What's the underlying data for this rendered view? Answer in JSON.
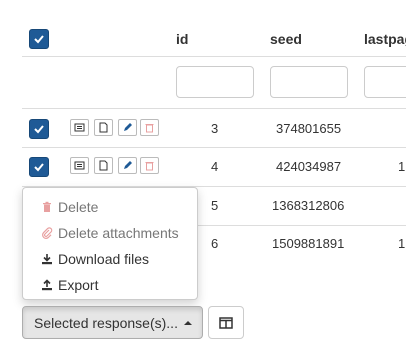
{
  "table": {
    "headers": [
      "id",
      "seed",
      "lastpage"
    ],
    "rows": [
      {
        "checked": true,
        "id": "3",
        "seed": "374801655",
        "lastpage": ""
      },
      {
        "checked": true,
        "id": "4",
        "seed": "424034987",
        "lastpage": "1"
      },
      {
        "checked": false,
        "id": "5",
        "seed": "1368312806",
        "lastpage": ""
      },
      {
        "checked": false,
        "id": "6",
        "seed": "1509881891",
        "lastpage": "1"
      }
    ],
    "header_label_partial": "lastpag"
  },
  "dropdown": {
    "items": [
      {
        "label": "Delete",
        "icon": "trash-icon",
        "color": "#e8a0a0"
      },
      {
        "label": "Delete attachments",
        "icon": "paperclip-icon",
        "color": "#e8a0a0"
      },
      {
        "label": "Download files",
        "icon": "download-icon",
        "color": "#333333"
      },
      {
        "label": "Export",
        "icon": "upload-icon",
        "color": "#333333"
      }
    ]
  },
  "footer": {
    "selected_label": "Selected response(s)...",
    "columns_icon": "columns-icon"
  },
  "colors": {
    "checkbox": "#1f5a96",
    "disabled_icon": "#e8a0a0"
  }
}
